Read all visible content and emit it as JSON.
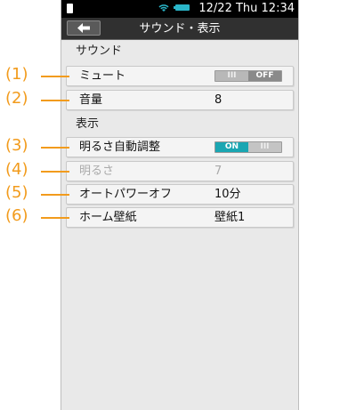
{
  "status_bar": {
    "datetime": "12/22 Thu 12:34",
    "wifi_icon": "wifi-icon",
    "battery_icon": "battery-icon"
  },
  "header": {
    "title": "サウンド・表示",
    "back_icon": "back-arrow-icon"
  },
  "sections": {
    "sound": "サウンド",
    "display": "表示"
  },
  "rows": {
    "mute": {
      "label": "ミュート",
      "toggle_left": "III",
      "toggle_right": "OFF",
      "state": "off"
    },
    "volume": {
      "label": "音量",
      "value": "8"
    },
    "auto_brightness": {
      "label": "明るさ自動調整",
      "toggle_left": "ON",
      "toggle_right": "III",
      "state": "on"
    },
    "brightness": {
      "label": "明るさ",
      "value": "7",
      "disabled": true
    },
    "auto_power_off": {
      "label": "オートパワーオフ",
      "value": "10分"
    },
    "home_wallpaper": {
      "label": "ホーム壁紙",
      "value": "壁紙1"
    }
  },
  "callouts": [
    "(1)",
    "(2)",
    "(3)",
    "(4)",
    "(5)",
    "(6)"
  ],
  "colors": {
    "callout": "#f29b1c",
    "toggle_on": "#1aa6b2"
  }
}
